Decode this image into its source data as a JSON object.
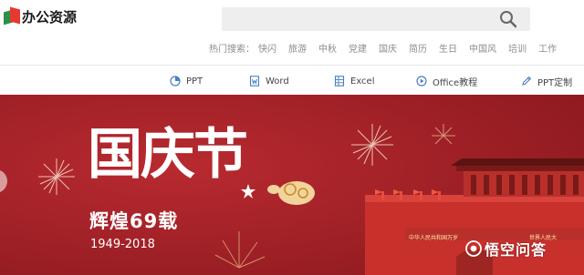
{
  "header": {
    "logo_text": "办公资源",
    "search": {
      "placeholder": ""
    },
    "hot_label": "热门搜索：",
    "hot_items": [
      "快闪",
      "旅游",
      "中秋",
      "党建",
      "国庆",
      "简历",
      "生日",
      "中国风",
      "培训",
      "工作"
    ]
  },
  "nav": {
    "items": [
      {
        "label": "PPT",
        "icon": "pie-chart-icon"
      },
      {
        "label": "Word",
        "icon": "word-doc-icon"
      },
      {
        "label": "Excel",
        "icon": "excel-sheet-icon"
      },
      {
        "label": "Office教程",
        "icon": "play-circle-icon"
      },
      {
        "label": "PPT定制",
        "icon": "pen-icon"
      }
    ]
  },
  "banner": {
    "title": "国庆节",
    "subtitle": "辉煌69载",
    "years": "1949-2018",
    "gate_caption": "中华人民共和国万岁",
    "gate_caption_right": "世界人民大",
    "background_color": "#a8222a"
  },
  "watermark": {
    "text": "悟空问答"
  }
}
